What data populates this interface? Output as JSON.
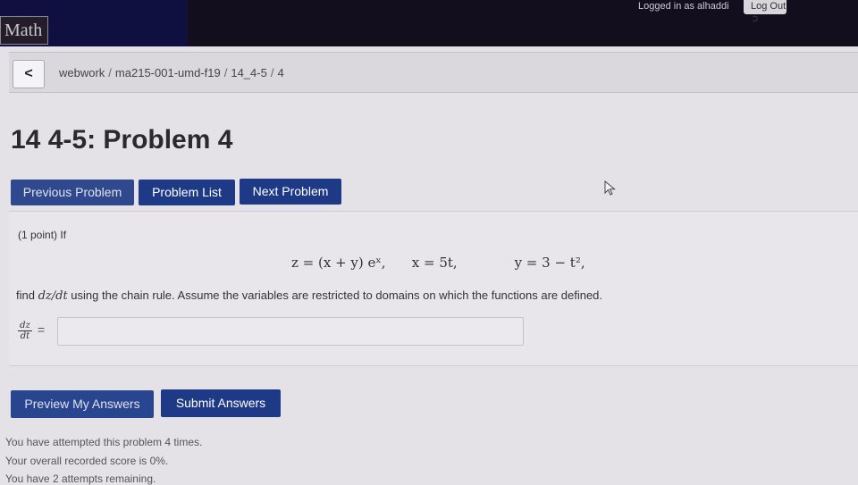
{
  "topbar": {
    "logo_text": "Math",
    "login_text": "Logged in as alhaddi",
    "logout_label": "Log Out"
  },
  "breadcrumb": {
    "back_symbol": "<",
    "items": [
      "webwork",
      "ma215-001-umd-f19",
      "14_4-5",
      "4"
    ]
  },
  "page_title": "14 4-5: Problem 4",
  "nav": {
    "previous_label": "Previous Problem",
    "list_label": "Problem List",
    "next_label": "Next Problem"
  },
  "problem": {
    "intro": "(1 point) If",
    "eq1": "z = (x + y) eˣ,",
    "eq2": "x = 5t,",
    "eq3": "y = 3 − t²,",
    "instruction_pre": "find ",
    "instruction_math": "dz/dt",
    "instruction_post": " using the chain rule. Assume the variables are restricted to domains on which the functions are defined.",
    "frac_num": "dz",
    "frac_den": "dt",
    "equals": "=",
    "answer_value": ""
  },
  "actions": {
    "preview_label": "Preview My Answers",
    "submit_label": "Submit Answers"
  },
  "status": {
    "line1": "You have attempted this problem 4 times.",
    "line2": "Your overall recorded score is 0%.",
    "line3": "You have 2 attempts remaining."
  }
}
